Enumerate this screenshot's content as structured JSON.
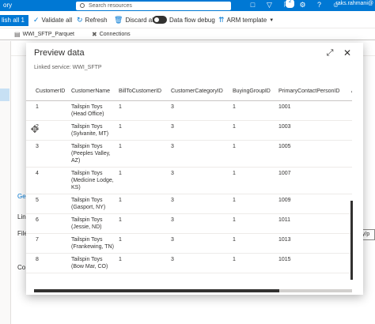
{
  "topbar": {
    "brand": "ory",
    "search_placeholder": "Search resources",
    "notif_count": "2",
    "user": "raks.rahmani@"
  },
  "cmdbar": {
    "publish_label": "lish all",
    "publish_count": "1",
    "validate_label": "Validate all",
    "refresh_label": "Refresh",
    "discard_label": "Discard all",
    "debug_label": "Data flow debug",
    "arm_label": "ARM template"
  },
  "tabs": [
    {
      "label": "WWI_SFTP_Parquet"
    },
    {
      "label": "Connections"
    }
  ],
  "background": {
    "ge_label": "Ge",
    "link_label": "Lin",
    "file_label": "File",
    "co_label": "Co",
    "right_box": "Yefty/p"
  },
  "dialog": {
    "title": "Preview data",
    "subtitle": "Linked service: WWI_SFTP",
    "columns": [
      "CustomerID",
      "CustomerName",
      "BillToCustomerID",
      "CustomerCategoryID",
      "BuyingGroupID",
      "PrimaryContactPersonID",
      "A"
    ],
    "rows": [
      [
        "1",
        "Tailspin Toys (Head Office)",
        "1",
        "3",
        "1",
        "1001",
        ""
      ],
      [
        "2",
        "Tailspin Toys (Sylvanite, MT)",
        "1",
        "3",
        "1",
        "1003",
        ""
      ],
      [
        "3",
        "Tailspin Toys (Peeples Valley, AZ)",
        "1",
        "3",
        "1",
        "1005",
        ""
      ],
      [
        "4",
        "Tailspin Toys (Medicine Lodge, KS)",
        "1",
        "3",
        "1",
        "1007",
        ""
      ],
      [
        "5",
        "Tailspin Toys (Gasport, NY)",
        "1",
        "3",
        "1",
        "1009",
        ""
      ],
      [
        "6",
        "Tailspin Toys (Jessie, ND)",
        "1",
        "3",
        "1",
        "1011",
        ""
      ],
      [
        "7",
        "Tailspin Toys (Frankewing, TN)",
        "1",
        "3",
        "1",
        "1013",
        ""
      ],
      [
        "8",
        "Tailspin Toys (Bow Mar, CO)",
        "1",
        "3",
        "1",
        "1015",
        ""
      ]
    ]
  }
}
